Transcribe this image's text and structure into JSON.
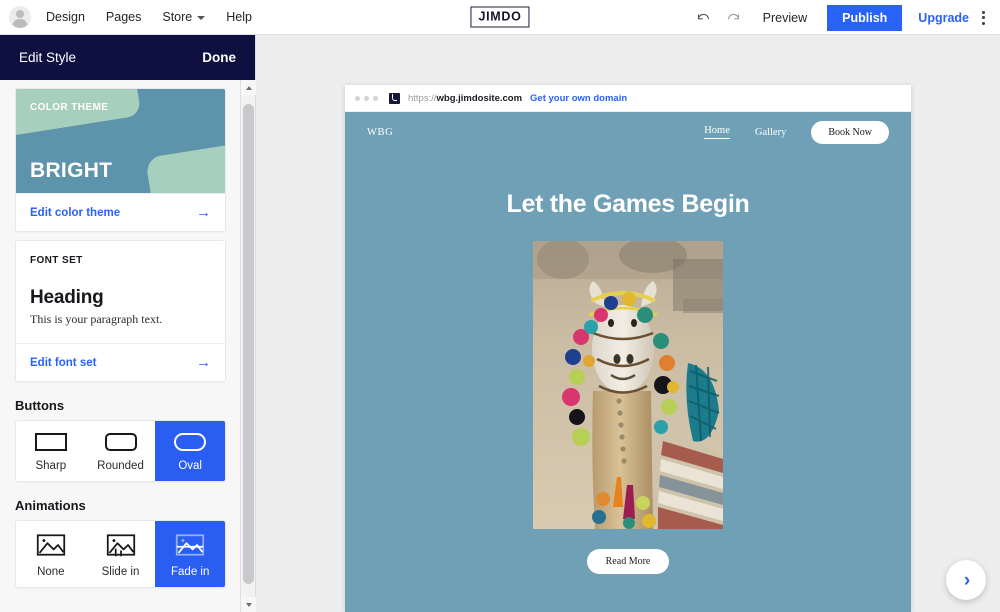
{
  "topbar": {
    "avatar_name": "user-avatar",
    "menu": [
      {
        "label": "Design",
        "has_caret": false
      },
      {
        "label": "Pages",
        "has_caret": false
      },
      {
        "label": "Store",
        "has_caret": true
      },
      {
        "label": "Help",
        "has_caret": false
      }
    ],
    "logo": "JIMDO",
    "undo_icon": "undo-icon",
    "redo_icon": "redo-icon",
    "preview_label": "Preview",
    "publish_label": "Publish",
    "upgrade_label": "Upgrade",
    "more_icon": "kebab-menu-icon",
    "accent_color": "#2962f6"
  },
  "sidebar": {
    "title": "Edit Style",
    "done_label": "Done",
    "header_bg": "#0e1040",
    "color_theme": {
      "kicker": "COLOR THEME",
      "name": "BRIGHT",
      "link_label": "Edit color theme",
      "preview_bg": "#5d93ab",
      "preview_accent": "#a7cfbd"
    },
    "font_set": {
      "kicker": "FONT SET",
      "heading_sample": "Heading",
      "paragraph_sample": "This is your paragraph text.",
      "link_label": "Edit font set"
    },
    "buttons": {
      "section_title": "Buttons",
      "options": [
        {
          "label": "Sharp",
          "icon": "sharp-rect-icon",
          "selected": false
        },
        {
          "label": "Rounded",
          "icon": "rounded-rect-icon",
          "selected": false
        },
        {
          "label": "Oval",
          "icon": "oval-rect-icon",
          "selected": true
        }
      ]
    },
    "animations": {
      "section_title": "Animations",
      "options": [
        {
          "label": "None",
          "icon": "image-icon",
          "selected": false
        },
        {
          "label": "Slide in",
          "icon": "image-slide-in-icon",
          "selected": false
        },
        {
          "label": "Fade in",
          "icon": "image-fade-in-icon",
          "selected": true
        }
      ]
    },
    "scrollbar": {
      "up_icon": "scroll-up-arrow-icon",
      "down_icon": "scroll-down-arrow-icon"
    }
  },
  "preview": {
    "browser": {
      "url_scheme": "https://",
      "url_domain": "wbg.jimdosite.com",
      "domain_link_label": "Get your own domain",
      "favicon": "jimdo-favicon"
    },
    "site": {
      "logo": "WBG",
      "nav": [
        {
          "label": "Home",
          "active": true
        },
        {
          "label": "Gallery",
          "active": false
        }
      ],
      "cta_label": "Book Now",
      "hero_title": "Let the Games Begin",
      "read_more_label": "Read More",
      "image_alt": "decorated-camel-photo",
      "background_color": "#6fa0b5"
    }
  },
  "fab": {
    "icon": "chevron-right-icon",
    "color": "#2962f6"
  }
}
